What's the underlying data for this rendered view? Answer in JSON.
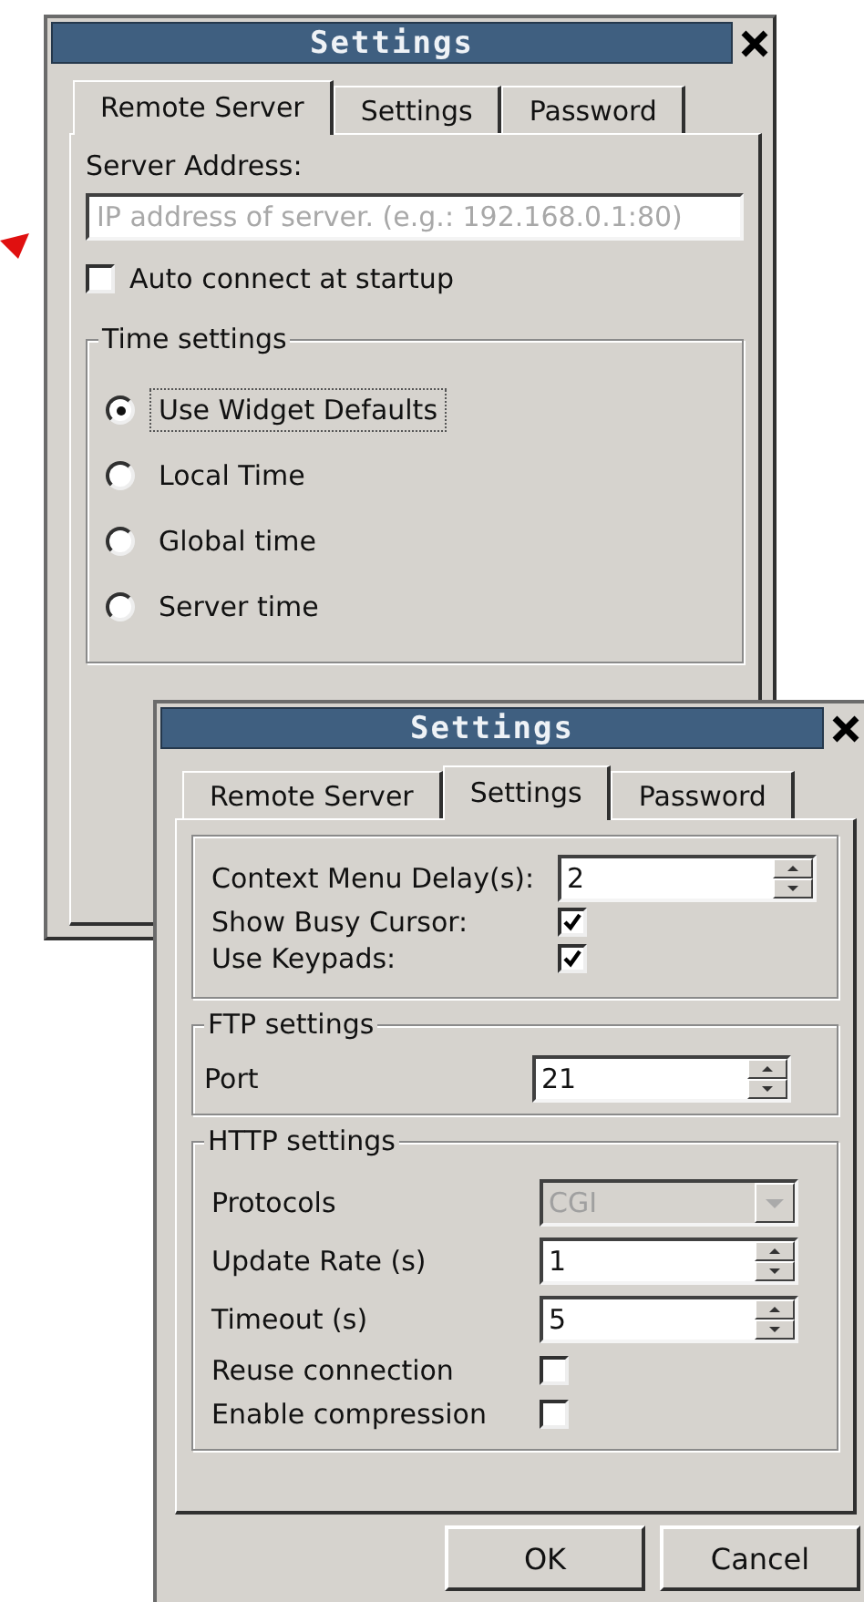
{
  "windows": [
    {
      "kind": "remote_server",
      "title": "Settings",
      "tabs": [
        {
          "label": "Remote Server",
          "selected": true
        },
        {
          "label": "Settings",
          "selected": false
        },
        {
          "label": "Password",
          "selected": false
        }
      ],
      "server_address": {
        "label": "Server Address:",
        "placeholder": "IP address of server. (e.g.: 192.168.0.1:80)"
      },
      "auto_connect": {
        "label": "Auto connect at startup",
        "checked": false
      },
      "time_settings": {
        "title": "Time settings",
        "options": [
          {
            "label": "Use Widget Defaults",
            "selected": true
          },
          {
            "label": "Local Time",
            "selected": false
          },
          {
            "label": "Global time",
            "selected": false
          },
          {
            "label": "Server time",
            "selected": false
          }
        ]
      }
    },
    {
      "kind": "settings",
      "title": "Settings",
      "tabs": [
        {
          "label": "Remote Server",
          "selected": false
        },
        {
          "label": "Settings",
          "selected": true
        },
        {
          "label": "Password",
          "selected": false
        }
      ],
      "general": [
        {
          "kind": "spin",
          "label": "Context Menu Delay(s):",
          "value": "2"
        },
        {
          "kind": "check",
          "label": "Show Busy Cursor:",
          "checked": true
        },
        {
          "kind": "check",
          "label": "Use Keypads:",
          "checked": true
        }
      ],
      "groups": [
        {
          "title": "FTP settings",
          "rows": [
            {
              "kind": "spin",
              "label": "Port",
              "value": "21"
            }
          ]
        },
        {
          "title": "HTTP settings",
          "rows": [
            {
              "kind": "combo",
              "label": "Protocols",
              "value": "CGI",
              "disabled": true
            },
            {
              "kind": "spin",
              "label": "Update Rate (s)",
              "value": "1"
            },
            {
              "kind": "spin",
              "label": "Timeout (s)",
              "value": "5"
            },
            {
              "kind": "check",
              "label": "Reuse connection",
              "checked": false
            },
            {
              "kind": "check",
              "label": "Enable compression",
              "checked": false
            }
          ]
        }
      ],
      "buttons": [
        "OK",
        "Cancel"
      ]
    }
  ]
}
